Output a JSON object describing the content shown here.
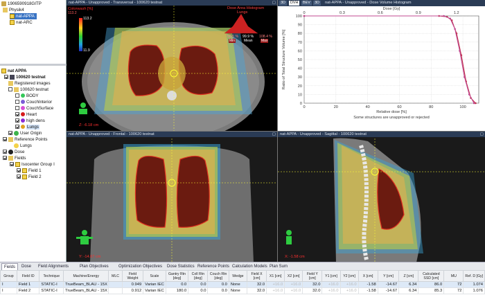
{
  "patient": {
    "id": "1906590918GITP",
    "course": "Physik4",
    "plans": [
      "nat-APPA",
      "nat-ARC"
    ],
    "selected_plan": "nat-APPA"
  },
  "structure_tree": {
    "root": "nat APPA",
    "image": "100620 testnat",
    "registered_images": "Registered images",
    "structure_set": "100620 testnat",
    "structures": [
      {
        "name": "BODY",
        "color": "#34c759"
      },
      {
        "name": "CouchInterior",
        "color": "#7b5cd6"
      },
      {
        "name": "CouchSurface",
        "color": "#d84fd6"
      },
      {
        "name": "Heart",
        "color": "#d61b1b"
      },
      {
        "name": "high dens",
        "color": "#8c2bd6"
      },
      {
        "name": "Lungs",
        "color": "#e0a020"
      }
    ],
    "user_origin": "User Origin",
    "reference_points": "Reference Points",
    "ref_lungs": "Lungs",
    "dose": "Dose",
    "fields": "Fields",
    "isocenter_group": "Isocenter Group I",
    "field_items": [
      "Field 1",
      "Field 2"
    ]
  },
  "views": {
    "transversal": {
      "title": "nat-APPA - Unapproved - Transversal - 100620 testnat",
      "coord": "Z: -6.18 cm"
    },
    "frontal": {
      "title": "nat-APPA - Unapproved - Frontal - 100620 testnat",
      "coord": "Y: -14.67 cm"
    },
    "sagittal": {
      "title": "nat-APPA - Unapproved - Sagittal - 100620 testnat",
      "coord": "X: -1.58 cm"
    }
  },
  "colorwash": {
    "label": "Colorwash [%]",
    "max": "113.2",
    "top": "113.2",
    "min": "11.9"
  },
  "histogram": {
    "title": "Dose Area Histogram",
    "structure": "Lungs",
    "min_val": "50.5 %",
    "min_label": "Min",
    "mean_val": "99.9 %",
    "mean_label": "Mean",
    "max_val": "108.4 %",
    "max_label": "Max"
  },
  "dvh": {
    "tabs": [
      "DVH",
      "BEV",
      "3D"
    ],
    "title": "nat-APPA - Unapproved - Dose Volume Histogram",
    "top_axis_label": "Dose [Gy]",
    "top_ticks": [
      "0",
      "0.3",
      "0.6",
      "0.9",
      "1.2"
    ],
    "ylabel": "Ratio of Total Structure Volume [%]",
    "xlabel": "Relative dose [%]",
    "footer": "Some structures are unapproved or rejected"
  },
  "chart_data": {
    "type": "line",
    "xlabel": "Relative dose [%]",
    "ylabel": "Ratio of Total Structure Volume [%]",
    "xlim": [
      0,
      110
    ],
    "ylim": [
      0,
      100
    ],
    "x_ticks": [
      0,
      20,
      40,
      60,
      80,
      100
    ],
    "y_ticks": [
      0,
      10,
      20,
      30,
      40,
      50,
      60,
      70,
      80,
      90,
      100
    ],
    "series": [
      {
        "color": "#c0304a",
        "x": [
          0,
          85,
          90,
          93,
          96,
          99,
          102,
          105,
          108
        ],
        "y": [
          100,
          100,
          99,
          95,
          80,
          55,
          25,
          6,
          0
        ]
      },
      {
        "color": "#c04890",
        "x": [
          0,
          88,
          92,
          95,
          98,
          101,
          104,
          107
        ],
        "y": [
          100,
          100,
          97,
          85,
          60,
          30,
          10,
          0
        ]
      }
    ]
  },
  "tabs": [
    "Fields",
    "Dose",
    "Field Alignments",
    "Plan Objectives",
    "Optimization Objectives",
    "Dose Statistics",
    "Reference Points",
    "Calculation Models",
    "Plan Sum"
  ],
  "table": {
    "headers": [
      "Group",
      "Field ID",
      "Technique",
      "Machine/Energy",
      "MLC",
      "Field Weight",
      "Scale",
      "Gantry Rtn [deg]",
      "Coll Rtn [deg]",
      "Couch Rtn [deg]",
      "Wedge",
      "Field X [cm]",
      "X1 [cm]",
      "X2 [cm]",
      "Field Y [cm]",
      "Y1 [cm]",
      "Y2 [cm]",
      "X [cm]",
      "Y [cm]",
      "Z [cm]",
      "Calculated SSD [cm]",
      "MU",
      "Ref. D [Gy]"
    ],
    "rows": [
      [
        "I",
        "Field 1",
        "STATIC-I",
        "TrueBeam_BLAU - 15X",
        "",
        "0.949",
        "Varian IEC",
        "0.0",
        "0.0",
        "0.0",
        "None",
        "32.0",
        "+16.0",
        "+16.0",
        "32.0",
        "+16.0",
        "+16.0",
        "-1.58",
        "-14.67",
        "6.34",
        "86.0",
        "72",
        "1.074"
      ],
      [
        "I",
        "Field 2",
        "STATIC-I",
        "TrueBeam_BLAU - 15X",
        "",
        "0.912",
        "Varian IEC",
        "180.0",
        "0.0",
        "0.0",
        "None",
        "32.0",
        "+16.0",
        "+16.0",
        "32.0",
        "+16.0",
        "+16.0",
        "-1.58",
        "-14.67",
        "6.34",
        "85.3",
        "72",
        "1.076"
      ]
    ]
  }
}
